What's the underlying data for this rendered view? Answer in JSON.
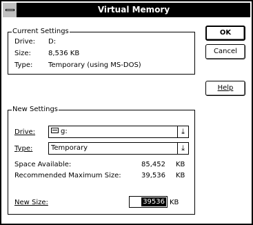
{
  "window": {
    "title": "Virtual Memory"
  },
  "buttons": {
    "ok": "OK",
    "cancel": "Cancel",
    "help": "Help"
  },
  "current": {
    "title": "Current Settings",
    "drive_label": "Drive:",
    "drive_value": "D:",
    "size_label": "Size:",
    "size_value": "8,536 KB",
    "type_label": "Type:",
    "type_value": "Temporary (using MS-DOS)"
  },
  "new": {
    "title": "New Settings",
    "drive_label": "Drive:",
    "drive_value": "g:",
    "type_label": "Type:",
    "type_value": "Temporary",
    "space_label": "Space Available:",
    "space_value": "85,452",
    "space_unit": "KB",
    "max_label": "Recommended Maximum Size:",
    "max_value": "39,536",
    "max_unit": "KB",
    "size_label": "New Size:",
    "size_value": "39536",
    "size_unit": "KB"
  },
  "icons": {
    "dropdown": "chevron-down-icon",
    "drive": "drive-icon",
    "system_menu": "system-menu-icon"
  }
}
